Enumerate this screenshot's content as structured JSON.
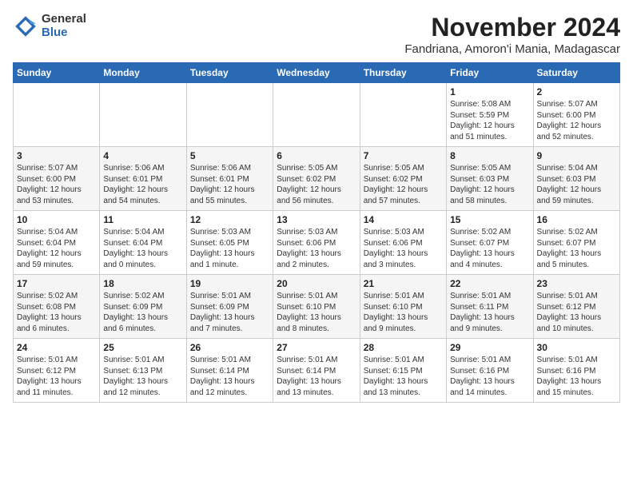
{
  "logo": {
    "general": "General",
    "blue": "Blue"
  },
  "header": {
    "month": "November 2024",
    "location": "Fandriana, Amoron'i Mania, Madagascar"
  },
  "weekdays": [
    "Sunday",
    "Monday",
    "Tuesday",
    "Wednesday",
    "Thursday",
    "Friday",
    "Saturday"
  ],
  "weeks": [
    [
      {
        "day": "",
        "info": ""
      },
      {
        "day": "",
        "info": ""
      },
      {
        "day": "",
        "info": ""
      },
      {
        "day": "",
        "info": ""
      },
      {
        "day": "",
        "info": ""
      },
      {
        "day": "1",
        "info": "Sunrise: 5:08 AM\nSunset: 5:59 PM\nDaylight: 12 hours\nand 51 minutes."
      },
      {
        "day": "2",
        "info": "Sunrise: 5:07 AM\nSunset: 6:00 PM\nDaylight: 12 hours\nand 52 minutes."
      }
    ],
    [
      {
        "day": "3",
        "info": "Sunrise: 5:07 AM\nSunset: 6:00 PM\nDaylight: 12 hours\nand 53 minutes."
      },
      {
        "day": "4",
        "info": "Sunrise: 5:06 AM\nSunset: 6:01 PM\nDaylight: 12 hours\nand 54 minutes."
      },
      {
        "day": "5",
        "info": "Sunrise: 5:06 AM\nSunset: 6:01 PM\nDaylight: 12 hours\nand 55 minutes."
      },
      {
        "day": "6",
        "info": "Sunrise: 5:05 AM\nSunset: 6:02 PM\nDaylight: 12 hours\nand 56 minutes."
      },
      {
        "day": "7",
        "info": "Sunrise: 5:05 AM\nSunset: 6:02 PM\nDaylight: 12 hours\nand 57 minutes."
      },
      {
        "day": "8",
        "info": "Sunrise: 5:05 AM\nSunset: 6:03 PM\nDaylight: 12 hours\nand 58 minutes."
      },
      {
        "day": "9",
        "info": "Sunrise: 5:04 AM\nSunset: 6:03 PM\nDaylight: 12 hours\nand 59 minutes."
      }
    ],
    [
      {
        "day": "10",
        "info": "Sunrise: 5:04 AM\nSunset: 6:04 PM\nDaylight: 12 hours\nand 59 minutes."
      },
      {
        "day": "11",
        "info": "Sunrise: 5:04 AM\nSunset: 6:04 PM\nDaylight: 13 hours\nand 0 minutes."
      },
      {
        "day": "12",
        "info": "Sunrise: 5:03 AM\nSunset: 6:05 PM\nDaylight: 13 hours\nand 1 minute."
      },
      {
        "day": "13",
        "info": "Sunrise: 5:03 AM\nSunset: 6:06 PM\nDaylight: 13 hours\nand 2 minutes."
      },
      {
        "day": "14",
        "info": "Sunrise: 5:03 AM\nSunset: 6:06 PM\nDaylight: 13 hours\nand 3 minutes."
      },
      {
        "day": "15",
        "info": "Sunrise: 5:02 AM\nSunset: 6:07 PM\nDaylight: 13 hours\nand 4 minutes."
      },
      {
        "day": "16",
        "info": "Sunrise: 5:02 AM\nSunset: 6:07 PM\nDaylight: 13 hours\nand 5 minutes."
      }
    ],
    [
      {
        "day": "17",
        "info": "Sunrise: 5:02 AM\nSunset: 6:08 PM\nDaylight: 13 hours\nand 6 minutes."
      },
      {
        "day": "18",
        "info": "Sunrise: 5:02 AM\nSunset: 6:09 PM\nDaylight: 13 hours\nand 6 minutes."
      },
      {
        "day": "19",
        "info": "Sunrise: 5:01 AM\nSunset: 6:09 PM\nDaylight: 13 hours\nand 7 minutes."
      },
      {
        "day": "20",
        "info": "Sunrise: 5:01 AM\nSunset: 6:10 PM\nDaylight: 13 hours\nand 8 minutes."
      },
      {
        "day": "21",
        "info": "Sunrise: 5:01 AM\nSunset: 6:10 PM\nDaylight: 13 hours\nand 9 minutes."
      },
      {
        "day": "22",
        "info": "Sunrise: 5:01 AM\nSunset: 6:11 PM\nDaylight: 13 hours\nand 9 minutes."
      },
      {
        "day": "23",
        "info": "Sunrise: 5:01 AM\nSunset: 6:12 PM\nDaylight: 13 hours\nand 10 minutes."
      }
    ],
    [
      {
        "day": "24",
        "info": "Sunrise: 5:01 AM\nSunset: 6:12 PM\nDaylight: 13 hours\nand 11 minutes."
      },
      {
        "day": "25",
        "info": "Sunrise: 5:01 AM\nSunset: 6:13 PM\nDaylight: 13 hours\nand 12 minutes."
      },
      {
        "day": "26",
        "info": "Sunrise: 5:01 AM\nSunset: 6:14 PM\nDaylight: 13 hours\nand 12 minutes."
      },
      {
        "day": "27",
        "info": "Sunrise: 5:01 AM\nSunset: 6:14 PM\nDaylight: 13 hours\nand 13 minutes."
      },
      {
        "day": "28",
        "info": "Sunrise: 5:01 AM\nSunset: 6:15 PM\nDaylight: 13 hours\nand 13 minutes."
      },
      {
        "day": "29",
        "info": "Sunrise: 5:01 AM\nSunset: 6:16 PM\nDaylight: 13 hours\nand 14 minutes."
      },
      {
        "day": "30",
        "info": "Sunrise: 5:01 AM\nSunset: 6:16 PM\nDaylight: 13 hours\nand 15 minutes."
      }
    ]
  ]
}
